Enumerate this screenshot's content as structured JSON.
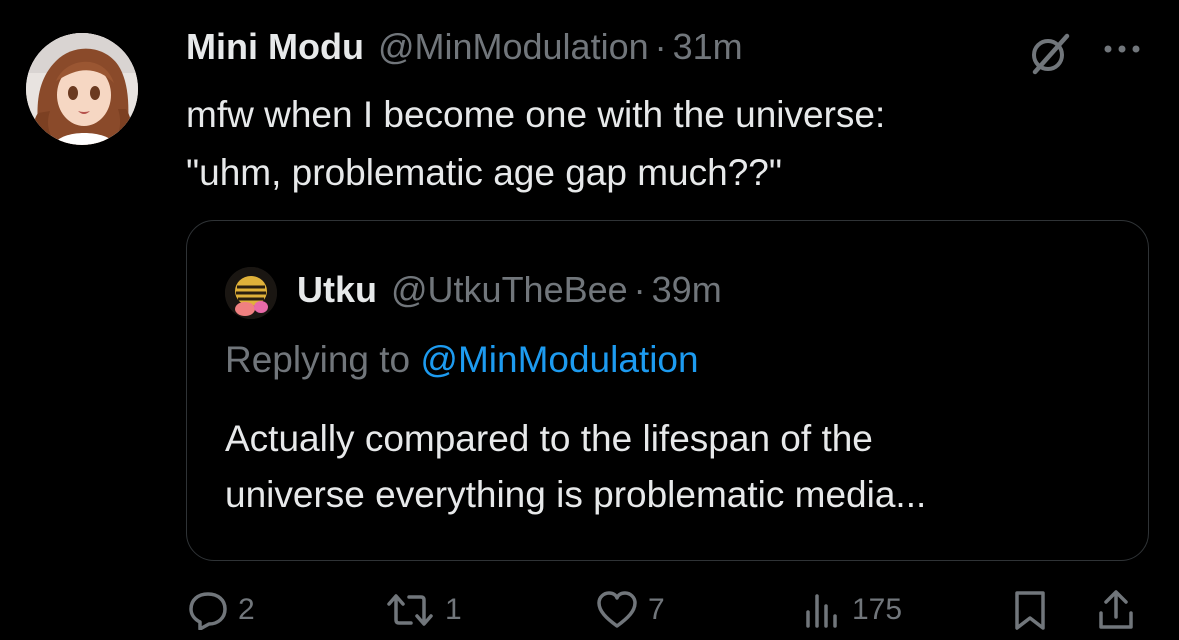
{
  "tweet": {
    "author_name": "Mini Modu",
    "author_handle": "@MinModulation",
    "separator": "·",
    "time": "31m",
    "text_lines": [
      "mfw when I become one with the universe:",
      "\"uhm, problematic age gap much??\""
    ]
  },
  "quoted_tweet": {
    "author_name": "Utku",
    "author_handle": "@UtkuTheBee",
    "separator": "·",
    "time": "39m",
    "replying_prefix": "Replying to ",
    "replying_handle": "@MinModulation",
    "text_lines": [
      "Actually compared to the lifespan of the",
      "universe everything is problematic media..."
    ]
  },
  "actions": {
    "replies": "2",
    "reposts": "1",
    "likes": "7",
    "views": "175"
  },
  "icons": [
    "grok-icon",
    "more-icon",
    "reply-icon",
    "repost-icon",
    "like-icon",
    "views-icon",
    "bookmark-icon",
    "share-icon"
  ],
  "colors": {
    "background": "#000000",
    "text": "#e7e9ea",
    "secondary": "#71767b",
    "link": "#1d9bf0",
    "border": "#2f3336"
  }
}
